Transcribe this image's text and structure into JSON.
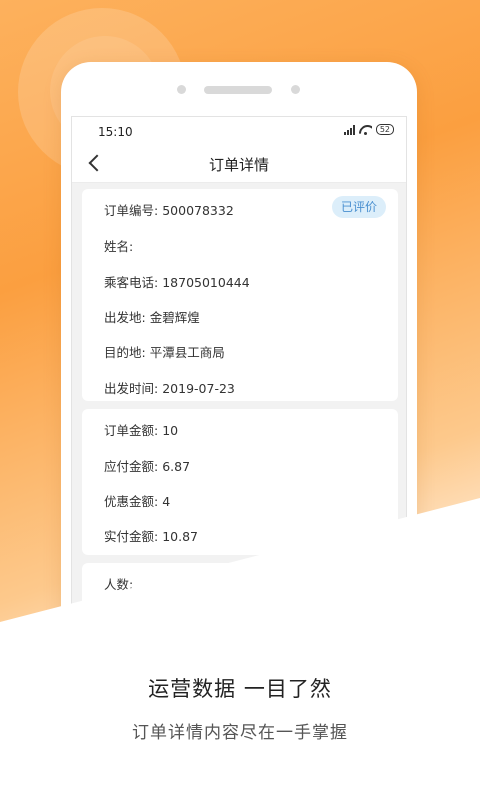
{
  "status_bar": {
    "time": "15:10",
    "battery": "52"
  },
  "header": {
    "title": "订单详情"
  },
  "order_card": {
    "badge": "已评价",
    "fields": [
      {
        "label": "订单编号:",
        "value": "500078332"
      },
      {
        "label": "姓名:",
        "value": ""
      },
      {
        "label": "乘客电话:",
        "value": "18705010444"
      },
      {
        "label": "出发地:",
        "value": "金碧辉煌"
      },
      {
        "label": "目的地:",
        "value": "平潭县工商局"
      },
      {
        "label": "出发时间:",
        "value": "2019-07-23"
      }
    ]
  },
  "amount_card": {
    "fields": [
      {
        "label": "订单金额:",
        "value": "10"
      },
      {
        "label": "应付金额:",
        "value": "6.87"
      },
      {
        "label": "优惠金额:",
        "value": "4"
      },
      {
        "label": "实付金额:",
        "value": "10.87"
      }
    ]
  },
  "people_card": {
    "fields": [
      {
        "label": "人数:",
        "value": ""
      }
    ]
  },
  "promo": {
    "headline": "运营数据 一目了然",
    "subline": "订单详情内容尽在一手掌握"
  },
  "colors": {
    "accent_orange": "#fb9f40",
    "badge_bg": "#dceefa",
    "badge_text": "#4a90d0"
  }
}
